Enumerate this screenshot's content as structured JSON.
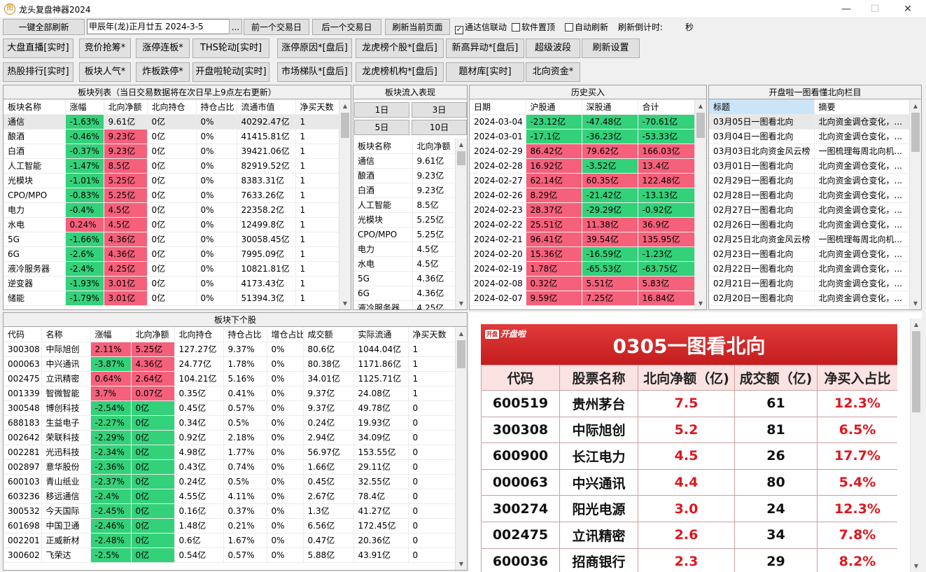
{
  "window": {
    "title": "龙头复盘神器2024",
    "icon": "图"
  },
  "toolbar": {
    "refresh_all": "一键全部刷新",
    "date_value": "甲辰年(龙)正月廿五  2024-3-5",
    "date_more": "...",
    "prev_day": "前一个交易日",
    "next_day": "后一个交易日",
    "refresh_page": "刷新当前页面",
    "chk_tdx": "通达信联动",
    "chk_tdx_checked": true,
    "chk_top": "软件置顶",
    "chk_top_checked": false,
    "chk_auto": "自动刷新",
    "chk_auto_checked": false,
    "countdown_label": "刷新倒计时:",
    "countdown_unit": "秒"
  },
  "nav_row1": [
    "大盘直播[实时]",
    "竞价抢筹*",
    "涨停连板*",
    "THS轮动[实时]",
    "涨停原因*[盘后]",
    "龙虎榜个股*[盘后]",
    "新高异动*[盘后]",
    "超级波段",
    "刷新设置"
  ],
  "nav_row2": [
    "热股排行[实时]",
    "板块人气*",
    "炸板跌停*",
    "开盘啦轮动[实时]",
    "市场梯队*[盘后]",
    "龙虎榜机构*[盘后]",
    "题材库[实时]",
    "北向资金*"
  ],
  "sector_list": {
    "title": "板块列表（当日交易数据将在次日早上9点左右更新）",
    "headers": [
      "板块名称",
      "涨幅",
      "北向净额",
      "北向持仓",
      "持仓占比",
      "流通市值",
      "净买天数"
    ],
    "rows": [
      [
        "通信",
        "-1.63%",
        "9.61亿",
        "0亿",
        "0%",
        "40292.47亿",
        "1"
      ],
      [
        "酿酒",
        "-0.46%",
        "9.23亿",
        "0亿",
        "0%",
        "41415.81亿",
        "1"
      ],
      [
        "白酒",
        "-0.37%",
        "9.23亿",
        "0亿",
        "0%",
        "39421.06亿",
        "1"
      ],
      [
        "人工智能",
        "-1.47%",
        "8.5亿",
        "0亿",
        "0%",
        "82919.52亿",
        "1"
      ],
      [
        "光模块",
        "-1.01%",
        "5.25亿",
        "0亿",
        "0%",
        "8383.31亿",
        "1"
      ],
      [
        "CPO/MPO",
        "-0.83%",
        "5.25亿",
        "0亿",
        "0%",
        "7633.26亿",
        "1"
      ],
      [
        "电力",
        "-0.4%",
        "4.5亿",
        "0亿",
        "0%",
        "22358.2亿",
        "1"
      ],
      [
        "水电",
        "0.24%",
        "4.5亿",
        "0亿",
        "0%",
        "12499.8亿",
        "1"
      ],
      [
        "5G",
        "-1.66%",
        "4.36亿",
        "0亿",
        "0%",
        "30058.45亿",
        "1"
      ],
      [
        "6G",
        "-2.6%",
        "4.36亿",
        "0亿",
        "0%",
        "7995.09亿",
        "1"
      ],
      [
        "液冷服务器",
        "-2.4%",
        "4.25亿",
        "0亿",
        "0%",
        "10821.81亿",
        "1"
      ],
      [
        "逆变器",
        "-1.93%",
        "3.01亿",
        "0亿",
        "0%",
        "4173.43亿",
        "1"
      ],
      [
        "储能",
        "-1.79%",
        "3.01亿",
        "0亿",
        "0%",
        "51394.3亿",
        "1"
      ]
    ]
  },
  "sector_flow": {
    "title": "板块流入表现",
    "buttons": [
      "1日",
      "3日",
      "5日",
      "10日"
    ],
    "headers": [
      "板块名称",
      "北向净额"
    ],
    "rows": [
      [
        "通信",
        "9.61亿"
      ],
      [
        "酿酒",
        "9.23亿"
      ],
      [
        "白酒",
        "9.23亿"
      ],
      [
        "人工智能",
        "8.5亿"
      ],
      [
        "光模块",
        "5.25亿"
      ],
      [
        "CPO/MPO",
        "5.25亿"
      ],
      [
        "电力",
        "4.5亿"
      ],
      [
        "水电",
        "4.5亿"
      ],
      [
        "5G",
        "4.36亿"
      ],
      [
        "6G",
        "4.36亿"
      ],
      [
        "液冷服务器",
        "4.25亿"
      ]
    ]
  },
  "history": {
    "title": "历史买入",
    "headers": [
      "日期",
      "沪股通",
      "深股通",
      "合计"
    ],
    "rows": [
      [
        "2024-03-04",
        "-23.12亿",
        "-47.48亿",
        "-70.61亿"
      ],
      [
        "2024-03-01",
        "-17.1亿",
        "-36.23亿",
        "-53.33亿"
      ],
      [
        "2024-02-29",
        "86.42亿",
        "79.62亿",
        "166.03亿"
      ],
      [
        "2024-02-28",
        "16.92亿",
        "-3.52亿",
        "13.4亿"
      ],
      [
        "2024-02-27",
        "62.14亿",
        "60.35亿",
        "122.48亿"
      ],
      [
        "2024-02-26",
        "8.29亿",
        "-21.42亿",
        "-13.13亿"
      ],
      [
        "2024-02-23",
        "28.37亿",
        "-29.29亿",
        "-0.92亿"
      ],
      [
        "2024-02-22",
        "25.51亿",
        "11.38亿",
        "36.9亿"
      ],
      [
        "2024-02-21",
        "96.41亿",
        "39.54亿",
        "135.95亿"
      ],
      [
        "2024-02-20",
        "15.36亿",
        "-16.59亿",
        "-1.23亿"
      ],
      [
        "2024-02-19",
        "1.78亿",
        "-65.53亿",
        "-63.75亿"
      ],
      [
        "2024-02-08",
        "0.32亿",
        "5.51亿",
        "5.83亿"
      ],
      [
        "2024-02-07",
        "9.59亿",
        "7.25亿",
        "16.84亿"
      ]
    ]
  },
  "kpl": {
    "title": "开盘啦一图看懂北向栏目",
    "headers": [
      "标题",
      "摘要"
    ],
    "rows": [
      [
        "03月05日一图看北向",
        "北向资金调仓变化，..."
      ],
      [
        "03月04日一图看北向",
        "北向资金调仓变化，..."
      ],
      [
        "03月03日北向资金风云榜",
        "一图梳理每周北向机..."
      ],
      [
        "03月01日一图看北向",
        "北向资金调仓变化，..."
      ],
      [
        "02月29日一图看北向",
        "北向资金调仓变化，..."
      ],
      [
        "02月28日一图看北向",
        "北向资金调仓变化，..."
      ],
      [
        "02月27日一图看北向",
        "北向资金调仓变化，..."
      ],
      [
        "02月26日一图看北向",
        "北向资金调仓变化，..."
      ],
      [
        "02月25日北向资金风云榜",
        "一图梳理每周北向机..."
      ],
      [
        "02月23日一图看北向",
        "北向资金调仓变化，..."
      ],
      [
        "02月22日一图看北向",
        "北向资金调仓变化，..."
      ],
      [
        "02月21日一图看北向",
        "北向资金调仓变化，..."
      ],
      [
        "02月20日一图看北向",
        "北向资金调仓变化，..."
      ]
    ]
  },
  "stocks": {
    "title": "板块下个股",
    "headers": [
      "代码",
      "名称",
      "涨幅",
      "北向净额",
      "北向持仓",
      "持仓占比",
      "增仓占比",
      "成交额",
      "实际流通",
      "净买天数"
    ],
    "rows": [
      [
        "300308",
        "中际旭创",
        "2.11%",
        "5.25亿",
        "127.27亿",
        "9.37%",
        "0%",
        "80.6亿",
        "1044.04亿",
        "1"
      ],
      [
        "000063",
        "中兴通讯",
        "-3.87%",
        "4.36亿",
        "24.77亿",
        "1.78%",
        "0%",
        "80.38亿",
        "1171.86亿",
        "1"
      ],
      [
        "002475",
        "立讯精密",
        "0.64%",
        "2.64亿",
        "104.21亿",
        "5.16%",
        "0%",
        "34.01亿",
        "1125.71亿",
        "1"
      ],
      [
        "001339",
        "智微智能",
        "3.7%",
        "0.07亿",
        "0.35亿",
        "0.41%",
        "0%",
        "9.37亿",
        "24.08亿",
        "1"
      ],
      [
        "300548",
        "博创科技",
        "-2.54%",
        "0亿",
        "0.45亿",
        "0.57%",
        "0%",
        "9.37亿",
        "49.78亿",
        "0"
      ],
      [
        "688183",
        "生益电子",
        "-2.27%",
        "0亿",
        "0.34亿",
        "0.5%",
        "0%",
        "0.24亿",
        "19.93亿",
        "0"
      ],
      [
        "002642",
        "荣联科技",
        "-2.29%",
        "0亿",
        "0.92亿",
        "2.18%",
        "0%",
        "2.94亿",
        "34.09亿",
        "0"
      ],
      [
        "002281",
        "光迅科技",
        "-2.34%",
        "0亿",
        "4.98亿",
        "1.77%",
        "0%",
        "56.97亿",
        "153.55亿",
        "0"
      ],
      [
        "002897",
        "意华股份",
        "-2.36%",
        "0亿",
        "0.43亿",
        "0.74%",
        "0%",
        "1.66亿",
        "29.11亿",
        "0"
      ],
      [
        "600103",
        "青山纸业",
        "-2.37%",
        "0亿",
        "0.24亿",
        "0.5%",
        "0%",
        "0.45亿",
        "32.55亿",
        "0"
      ],
      [
        "603236",
        "移远通信",
        "-2.4%",
        "0亿",
        "4.55亿",
        "4.11%",
        "0%",
        "2.67亿",
        "78.4亿",
        "0"
      ],
      [
        "300532",
        "今天国际",
        "-2.45%",
        "0亿",
        "0.16亿",
        "0.37%",
        "0%",
        "1.3亿",
        "41.27亿",
        "0"
      ],
      [
        "601698",
        "中国卫通",
        "-2.46%",
        "0亿",
        "1.48亿",
        "0.21%",
        "0%",
        "6.56亿",
        "172.45亿",
        "0"
      ],
      [
        "002201",
        "正威新材",
        "-2.48%",
        "0亿",
        "0.6亿",
        "1.67%",
        "0%",
        "0.47亿",
        "20.36亿",
        "0"
      ],
      [
        "300602",
        "飞荣达",
        "-2.5%",
        "0亿",
        "0.54亿",
        "0.57%",
        "0%",
        "5.88亿",
        "43.91亿",
        "0"
      ]
    ]
  },
  "image": {
    "logo_badge": "开盘",
    "logo_text": "开盘啦",
    "title": "0305一图看北向",
    "headers": [
      "代码",
      "股票名称",
      "北向净额（亿)",
      "成交额（亿)",
      "净买入占比"
    ],
    "rows": [
      [
        "600519",
        "贵州茅台",
        "7.5",
        "61",
        "12.3%"
      ],
      [
        "300308",
        "中际旭创",
        "5.2",
        "81",
        "6.5%"
      ],
      [
        "600900",
        "长江电力",
        "4.5",
        "26",
        "17.7%"
      ],
      [
        "000063",
        "中兴通讯",
        "4.4",
        "80",
        "5.4%"
      ],
      [
        "300274",
        "阳光电源",
        "3.0",
        "24",
        "12.3%"
      ],
      [
        "002475",
        "立讯精密",
        "2.6",
        "34",
        "7.8%"
      ],
      [
        "600036",
        "招商银行",
        "2.3",
        "29",
        "8.2%"
      ]
    ]
  },
  "colors": {
    "up": "#f5607b",
    "down": "#33d17a",
    "banner": "#c41d1d",
    "value_red": "#e0161e"
  }
}
